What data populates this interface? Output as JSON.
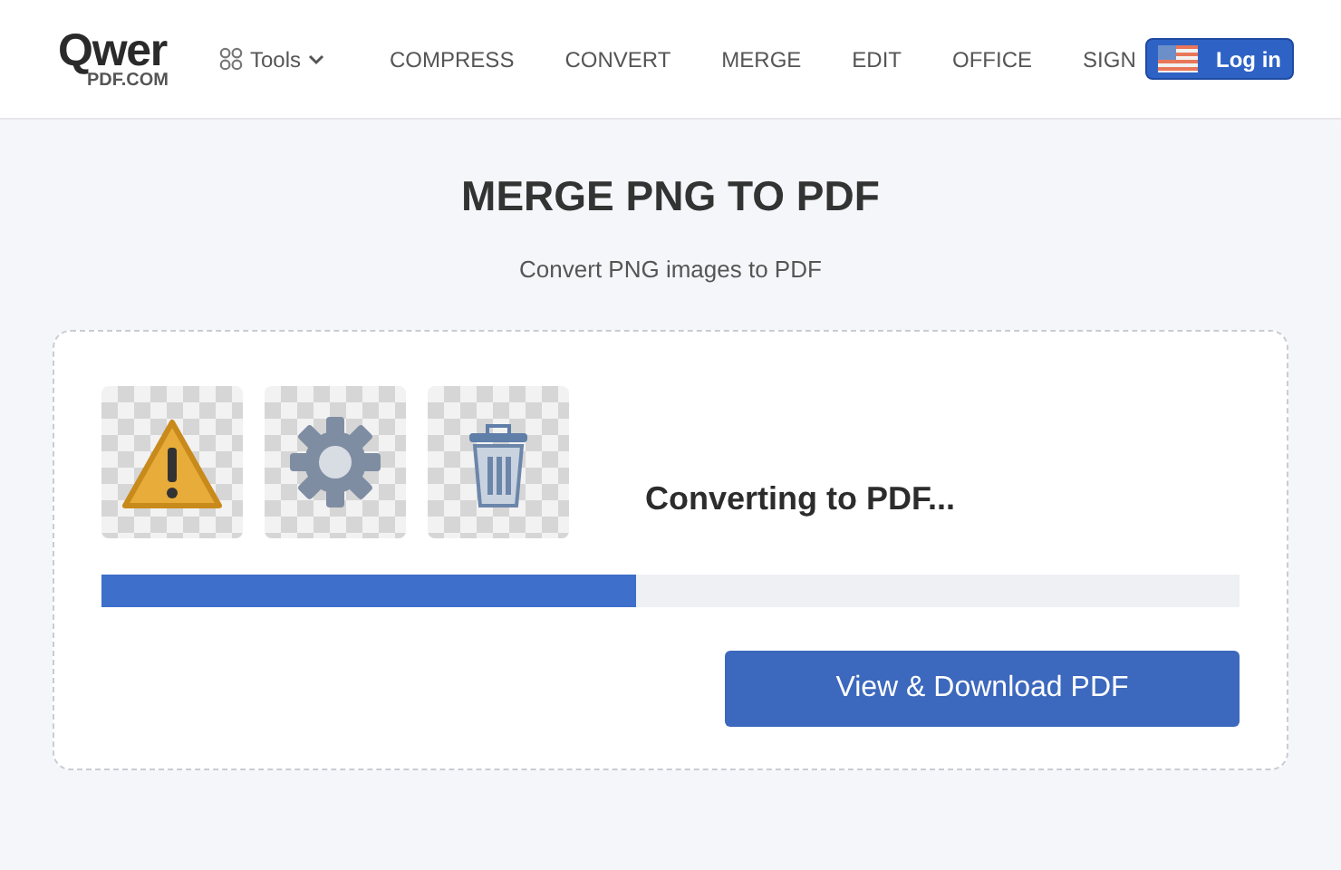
{
  "header": {
    "logo": {
      "word": "Qwer",
      "domain": "PDF.COM"
    },
    "tools_menu": {
      "label": "Tools",
      "expanded": false
    },
    "nav": [
      "COMPRESS",
      "CONVERT",
      "MERGE",
      "EDIT",
      "OFFICE",
      "SIGN"
    ],
    "login": "Log in"
  },
  "title": "MERGE PNG TO PDF",
  "subtitle": "Convert PNG images to PDF",
  "files": [
    {
      "kind": "warning"
    },
    {
      "kind": "gear"
    },
    {
      "kind": "trash"
    }
  ],
  "status": "Converting to PDF...",
  "progress": {
    "level": 0.47
  },
  "action": "View & Download PDF"
}
